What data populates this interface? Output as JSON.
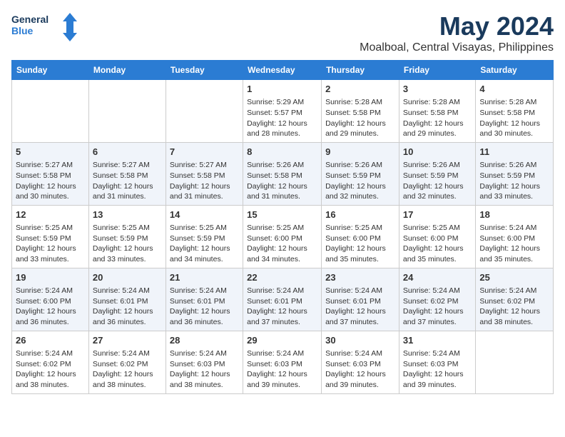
{
  "logo": {
    "line1": "General",
    "line2": "Blue"
  },
  "title": "May 2024",
  "location": "Moalboal, Central Visayas, Philippines",
  "days_of_week": [
    "Sunday",
    "Monday",
    "Tuesday",
    "Wednesday",
    "Thursday",
    "Friday",
    "Saturday"
  ],
  "weeks": [
    [
      {
        "day": "",
        "info": ""
      },
      {
        "day": "",
        "info": ""
      },
      {
        "day": "",
        "info": ""
      },
      {
        "day": "1",
        "info": "Sunrise: 5:29 AM\nSunset: 5:57 PM\nDaylight: 12 hours and 28 minutes."
      },
      {
        "day": "2",
        "info": "Sunrise: 5:28 AM\nSunset: 5:58 PM\nDaylight: 12 hours and 29 minutes."
      },
      {
        "day": "3",
        "info": "Sunrise: 5:28 AM\nSunset: 5:58 PM\nDaylight: 12 hours and 29 minutes."
      },
      {
        "day": "4",
        "info": "Sunrise: 5:28 AM\nSunset: 5:58 PM\nDaylight: 12 hours and 30 minutes."
      }
    ],
    [
      {
        "day": "5",
        "info": "Sunrise: 5:27 AM\nSunset: 5:58 PM\nDaylight: 12 hours and 30 minutes."
      },
      {
        "day": "6",
        "info": "Sunrise: 5:27 AM\nSunset: 5:58 PM\nDaylight: 12 hours and 31 minutes."
      },
      {
        "day": "7",
        "info": "Sunrise: 5:27 AM\nSunset: 5:58 PM\nDaylight: 12 hours and 31 minutes."
      },
      {
        "day": "8",
        "info": "Sunrise: 5:26 AM\nSunset: 5:58 PM\nDaylight: 12 hours and 31 minutes."
      },
      {
        "day": "9",
        "info": "Sunrise: 5:26 AM\nSunset: 5:59 PM\nDaylight: 12 hours and 32 minutes."
      },
      {
        "day": "10",
        "info": "Sunrise: 5:26 AM\nSunset: 5:59 PM\nDaylight: 12 hours and 32 minutes."
      },
      {
        "day": "11",
        "info": "Sunrise: 5:26 AM\nSunset: 5:59 PM\nDaylight: 12 hours and 33 minutes."
      }
    ],
    [
      {
        "day": "12",
        "info": "Sunrise: 5:25 AM\nSunset: 5:59 PM\nDaylight: 12 hours and 33 minutes."
      },
      {
        "day": "13",
        "info": "Sunrise: 5:25 AM\nSunset: 5:59 PM\nDaylight: 12 hours and 33 minutes."
      },
      {
        "day": "14",
        "info": "Sunrise: 5:25 AM\nSunset: 5:59 PM\nDaylight: 12 hours and 34 minutes."
      },
      {
        "day": "15",
        "info": "Sunrise: 5:25 AM\nSunset: 6:00 PM\nDaylight: 12 hours and 34 minutes."
      },
      {
        "day": "16",
        "info": "Sunrise: 5:25 AM\nSunset: 6:00 PM\nDaylight: 12 hours and 35 minutes."
      },
      {
        "day": "17",
        "info": "Sunrise: 5:25 AM\nSunset: 6:00 PM\nDaylight: 12 hours and 35 minutes."
      },
      {
        "day": "18",
        "info": "Sunrise: 5:24 AM\nSunset: 6:00 PM\nDaylight: 12 hours and 35 minutes."
      }
    ],
    [
      {
        "day": "19",
        "info": "Sunrise: 5:24 AM\nSunset: 6:00 PM\nDaylight: 12 hours and 36 minutes."
      },
      {
        "day": "20",
        "info": "Sunrise: 5:24 AM\nSunset: 6:01 PM\nDaylight: 12 hours and 36 minutes."
      },
      {
        "day": "21",
        "info": "Sunrise: 5:24 AM\nSunset: 6:01 PM\nDaylight: 12 hours and 36 minutes."
      },
      {
        "day": "22",
        "info": "Sunrise: 5:24 AM\nSunset: 6:01 PM\nDaylight: 12 hours and 37 minutes."
      },
      {
        "day": "23",
        "info": "Sunrise: 5:24 AM\nSunset: 6:01 PM\nDaylight: 12 hours and 37 minutes."
      },
      {
        "day": "24",
        "info": "Sunrise: 5:24 AM\nSunset: 6:02 PM\nDaylight: 12 hours and 37 minutes."
      },
      {
        "day": "25",
        "info": "Sunrise: 5:24 AM\nSunset: 6:02 PM\nDaylight: 12 hours and 38 minutes."
      }
    ],
    [
      {
        "day": "26",
        "info": "Sunrise: 5:24 AM\nSunset: 6:02 PM\nDaylight: 12 hours and 38 minutes."
      },
      {
        "day": "27",
        "info": "Sunrise: 5:24 AM\nSunset: 6:02 PM\nDaylight: 12 hours and 38 minutes."
      },
      {
        "day": "28",
        "info": "Sunrise: 5:24 AM\nSunset: 6:03 PM\nDaylight: 12 hours and 38 minutes."
      },
      {
        "day": "29",
        "info": "Sunrise: 5:24 AM\nSunset: 6:03 PM\nDaylight: 12 hours and 39 minutes."
      },
      {
        "day": "30",
        "info": "Sunrise: 5:24 AM\nSunset: 6:03 PM\nDaylight: 12 hours and 39 minutes."
      },
      {
        "day": "31",
        "info": "Sunrise: 5:24 AM\nSunset: 6:03 PM\nDaylight: 12 hours and 39 minutes."
      },
      {
        "day": "",
        "info": ""
      }
    ]
  ]
}
